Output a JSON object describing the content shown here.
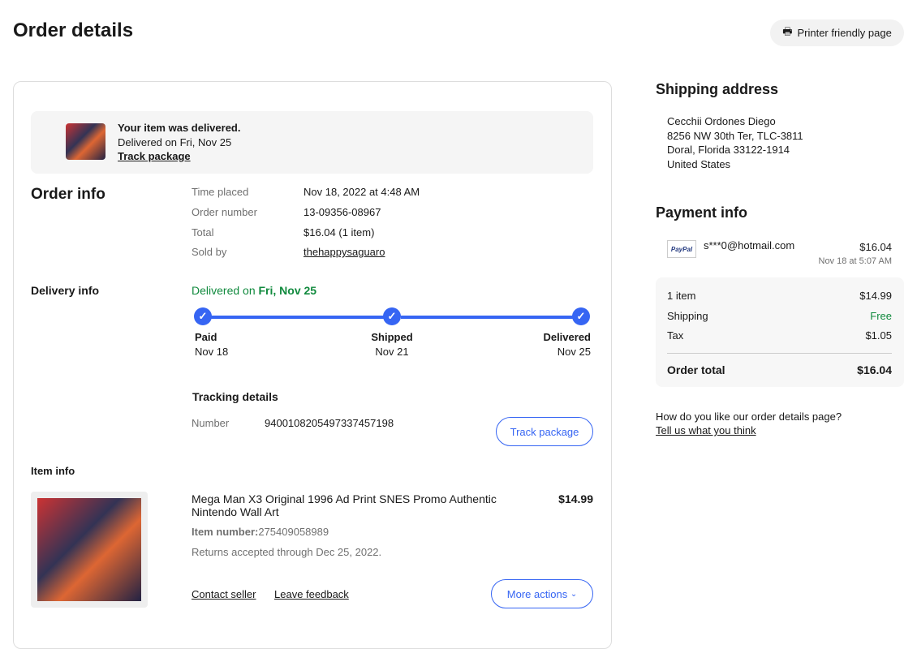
{
  "header": {
    "title": "Order details",
    "print_label": "Printer friendly page"
  },
  "banner": {
    "title": "Your item was delivered.",
    "subtitle": "Delivered on Fri, Nov 25",
    "link": "Track package"
  },
  "order_info": {
    "heading": "Order info",
    "rows": [
      {
        "label": "Time placed",
        "value": "Nov 18, 2022 at 4:48 AM"
      },
      {
        "label": "Order number",
        "value": "13-09356-08967"
      },
      {
        "label": "Total",
        "value": "$16.04 (1 item)"
      },
      {
        "label": "Sold by",
        "value": "thehappysaguaro"
      }
    ]
  },
  "delivery": {
    "heading": "Delivery info",
    "status_prefix": "Delivered on",
    "status_date": "Fri, Nov 25",
    "steps": [
      {
        "label": "Paid",
        "date": "Nov 18"
      },
      {
        "label": "Shipped",
        "date": "Nov 21"
      },
      {
        "label": "Delivered",
        "date": "Nov 25"
      }
    ],
    "tracking_heading": "Tracking details",
    "number_label": "Number",
    "number": "9400108205497337457198",
    "track_button": "Track package"
  },
  "item": {
    "heading": "Item info",
    "title": "Mega Man X3 Original 1996 Ad Print SNES Promo Authentic Nintendo Wall Art",
    "price": "$14.99",
    "number_label": "Item number:",
    "number": "275409058989",
    "returns": "Returns accepted through Dec 25, 2022.",
    "contact": "Contact seller",
    "feedback": "Leave feedback",
    "more": "More actions"
  },
  "shipping": {
    "heading": "Shipping address",
    "lines": [
      "Cecchii Ordones Diego",
      "8256 NW 30th Ter, TLC-3811",
      "Doral, Florida 33122-1914",
      "United States"
    ]
  },
  "payment": {
    "heading": "Payment info",
    "method": "PayPal",
    "account": "s***0@hotmail.com",
    "amount": "$16.04",
    "date": "Nov 18 at 5:07 AM",
    "summary": [
      {
        "label": "1 item",
        "value": "$14.99"
      },
      {
        "label": "Shipping",
        "value": "Free"
      },
      {
        "label": "Tax",
        "value": "$1.05"
      }
    ],
    "total_label": "Order total",
    "total": "$16.04"
  },
  "feedback": {
    "question": "How do you like our order details page?",
    "link": "Tell us what you think"
  },
  "colors": {
    "accent": "#3665f3",
    "green": "#118a3e"
  }
}
